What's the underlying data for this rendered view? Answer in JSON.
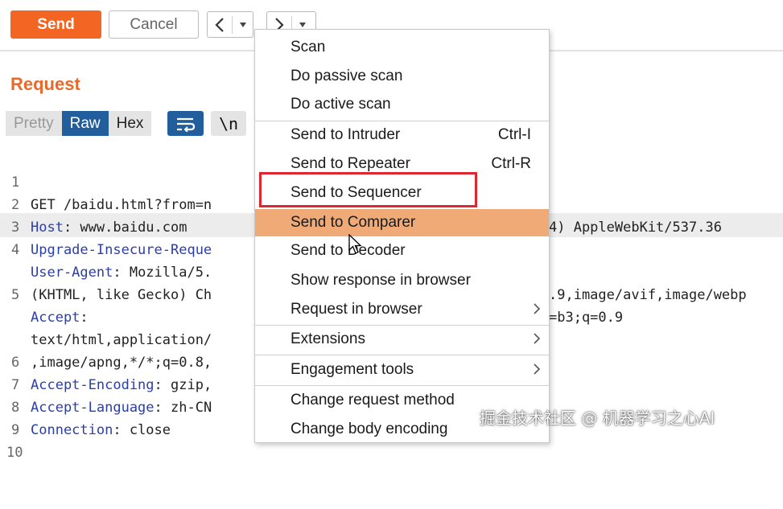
{
  "toolbar": {
    "send_label": "Send",
    "cancel_label": "Cancel",
    "back_glyph": "<",
    "forward_glyph": ">",
    "dropdown_glyph": "▾"
  },
  "request": {
    "title": "Request",
    "tabs": [
      "Pretty",
      "Raw",
      "Hex"
    ],
    "active_tab": "Raw",
    "wrap_icon": "wrap-lines-icon",
    "newline_toggle": "\\n"
  },
  "code_lines": [
    {
      "num": "1",
      "text": "GET /baidu.html?from=n"
    },
    {
      "num": "2",
      "key": "Host",
      "value": ": www.baidu.com"
    },
    {
      "num": "3",
      "key": "Upgrade-Insecure-Reque"
    },
    {
      "num": "4",
      "key": "User-Agent",
      "value": ": Mozilla/5."
    },
    {
      "num": "",
      "text": "(KHTML, like Gecko) Ch"
    },
    {
      "num": "5",
      "key": "Accept",
      "value": ":"
    },
    {
      "num": "",
      "text": "text/html,application/"
    },
    {
      "num": "",
      "text": ",image/apng,*/*;q=0.8,"
    },
    {
      "num": "6",
      "key": "Accept-Encoding",
      "value": ": gzip,"
    },
    {
      "num": "7",
      "key": "Accept-Language",
      "value": ": zh-CN"
    },
    {
      "num": "8",
      "key": "Connection",
      "value": ": close"
    },
    {
      "num": "9",
      "text": ""
    },
    {
      "num": "10",
      "text": ""
    }
  ],
  "code_right": {
    "line4": "4) AppleWebKit/537.36",
    "line5b": ".9,image/avif,image/webp",
    "line5c": "=b3;q=0.9"
  },
  "context_menu": {
    "items": [
      {
        "label": "Scan"
      },
      {
        "label": "Do passive scan"
      },
      {
        "label": "Do active scan"
      },
      {
        "label": "Send to Intruder",
        "shortcut": "Ctrl-I"
      },
      {
        "label": "Send to Repeater",
        "shortcut": "Ctrl-R"
      },
      {
        "label": "Send to Sequencer"
      },
      {
        "label": "Send to Comparer",
        "highlighted": true
      },
      {
        "label": "Send to Decoder"
      },
      {
        "label": "Show response in browser"
      },
      {
        "label": "Request in browser",
        "submenu": true
      },
      {
        "label": "Extensions",
        "submenu": true
      },
      {
        "label": "Engagement tools",
        "submenu": true
      },
      {
        "label": "Change request method"
      },
      {
        "label": "Change body encoding"
      }
    ],
    "highlight_color": "#efaa78",
    "annotation_color": "#e0262f"
  },
  "watermark": "掘金技术社区 @ 机器学习之心AI",
  "colors": {
    "accent": "#f26522",
    "tab_active": "#225e9b",
    "header_key": "#2b3ea8"
  }
}
